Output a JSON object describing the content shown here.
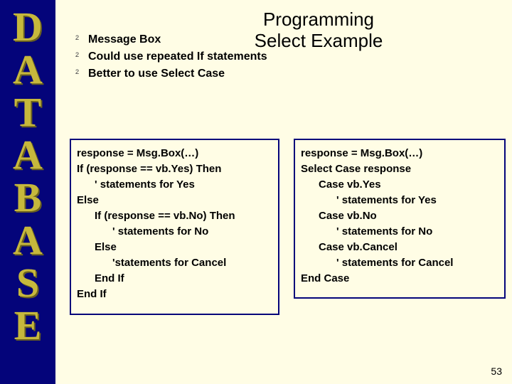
{
  "sidebar": {
    "letters": [
      "D",
      "A",
      "T",
      "A",
      "B",
      "A",
      "S",
      "E"
    ]
  },
  "title": {
    "line1": "Programming",
    "line2": "Select Example"
  },
  "bullets": {
    "b1": "Message Box",
    "b2": "Could use repeated If statements",
    "b3": "Better to use Select Case"
  },
  "code": {
    "left": "response = Msg.Box(…)\nIf (response == vb.Yes) Then\n      ' statements for Yes\nElse\n      If (response == vb.No) Then\n            ' statements for No\n      Else\n            'statements for Cancel\n      End If\nEnd If",
    "right": "response = Msg.Box(…)\nSelect Case response\n      Case vb.Yes\n            ' statements for Yes\n      Case vb.No\n            ' statements for No\n      Case vb.Cancel\n            ' statements for Cancel\nEnd Case"
  },
  "pagenum": "53"
}
